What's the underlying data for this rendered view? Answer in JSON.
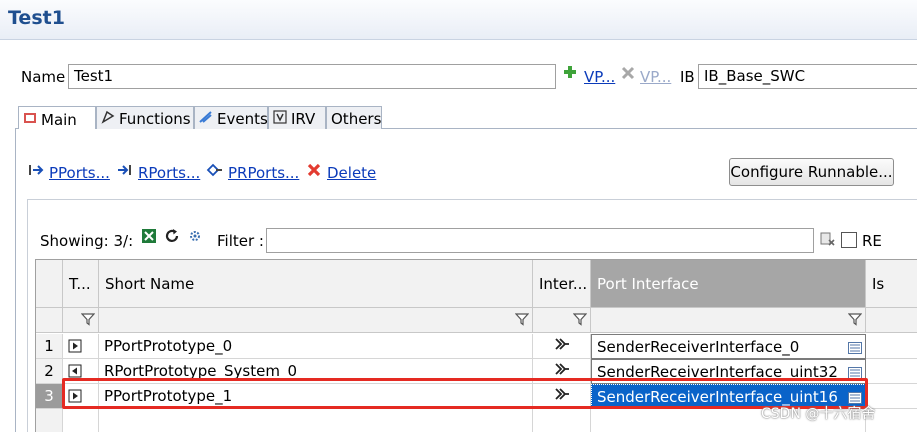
{
  "window": {
    "title": "Test1"
  },
  "form": {
    "name_label": "Name",
    "name_value": "Test1",
    "add_vp_label": "VP...",
    "remove_vp_label": "VP...",
    "ib_label": "IB",
    "ib_value": "IB_Base_SWC"
  },
  "tabs": [
    {
      "label": "Main",
      "active": true
    },
    {
      "label": "Functions",
      "active": false
    },
    {
      "label": "Events",
      "active": false
    },
    {
      "label": "IRV",
      "active": false
    },
    {
      "label": "Others",
      "active": false
    }
  ],
  "actions": {
    "pports": "PPorts...",
    "rports": "RPorts...",
    "prports": "PRPorts...",
    "delete": "Delete",
    "configure": "Configure Runnable..."
  },
  "toolbar": {
    "showing": "Showing: 3/:",
    "filter_label": "Filter :",
    "filter_value": "",
    "re_label": "RE"
  },
  "table": {
    "columns": [
      "T...",
      "Short Name",
      "Inter...",
      "Port Interface",
      "Is"
    ],
    "rows": [
      {
        "num": "1",
        "type": "pport",
        "short_name": "PPortPrototype_0",
        "port_interface": "SenderReceiverInterface_0",
        "selected": false
      },
      {
        "num": "2",
        "type": "rport",
        "short_name": "RPortPrototype_System_0",
        "port_interface": "SenderReceiverInterface_uint32",
        "selected": false
      },
      {
        "num": "3",
        "type": "pport",
        "short_name": "PPortPrototype_1",
        "port_interface": "SenderReceiverInterface_uint16",
        "selected": true
      }
    ]
  },
  "watermark": "CSDN @十六宿舍",
  "colors": {
    "link": "#0b3bba",
    "selection": "#0a63c9",
    "highlight": "#e52a22",
    "title": "#1f4f8f"
  }
}
